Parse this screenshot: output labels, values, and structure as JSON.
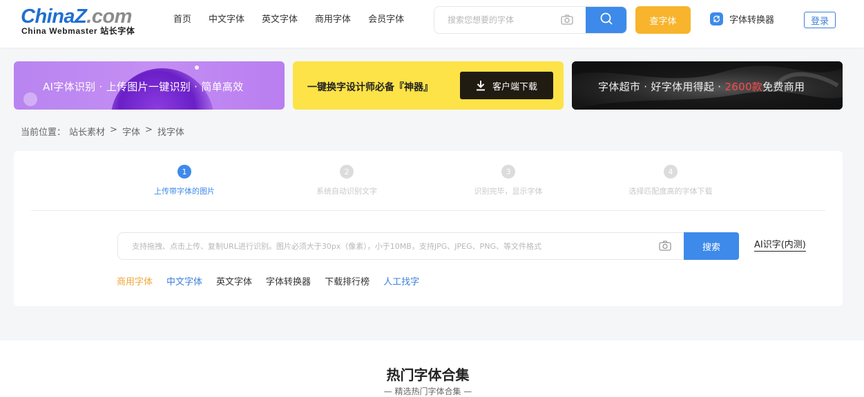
{
  "header": {
    "logo": {
      "main_blue": "China",
      "main_z": "Z",
      "main_gray": ".com",
      "sub": "China Webmaster 站长字体"
    },
    "nav": [
      "首页",
      "中文字体",
      "英文字体",
      "商用字体",
      "会员字体"
    ],
    "search": {
      "placeholder": "搜索您想要的字体",
      "camera_icon": "camera-icon",
      "search_icon": "search-icon"
    },
    "find_button": "查字体",
    "converter": {
      "label": "字体转换器",
      "icon": "converter-icon"
    },
    "login_button": "登录"
  },
  "banners": {
    "ai": "AI字体识别 · 上传图片一键识别 · 简单高效",
    "client": {
      "text": "一键换字设计师必备『神器』",
      "button": "客户端下载"
    },
    "market": {
      "text_before": "字体超市 · 好字体用得起 · ",
      "highlight": "2600款",
      "text_after": "免费商用"
    }
  },
  "breadcrumb": {
    "prefix": "当前位置：",
    "items": [
      "站长素材",
      "字体",
      "找字体"
    ],
    "separator": ">"
  },
  "steps": [
    {
      "num": "1",
      "label": "上传带字体的图片",
      "active": true
    },
    {
      "num": "2",
      "label": "系统自动识别文字",
      "active": false
    },
    {
      "num": "3",
      "label": "识别完毕，显示字体",
      "active": false
    },
    {
      "num": "4",
      "label": "选择匹配度高的字体下载",
      "active": false
    }
  ],
  "upload": {
    "placeholder": "支持拖拽、点击上传、复制URL进行识别。图片必须大于30px（像素），小于10MB，支持JPG、JPEG、PNG、等文件格式",
    "search_button": "搜索",
    "ai_link": "AI识字(内测)"
  },
  "quick_links": [
    {
      "label": "商用字体",
      "color": "#f0a73a"
    },
    {
      "label": "中文字体",
      "color": "#3d7fd9"
    },
    {
      "label": "英文字体",
      "color": "#333333"
    },
    {
      "label": "字体转换器",
      "color": "#333333"
    },
    {
      "label": "下载排行榜",
      "color": "#333333"
    },
    {
      "label": "人工找字",
      "color": "#3d7fd9"
    }
  ],
  "hot": {
    "title": "热门字体合集",
    "subtitle": "—   精选热门字体合集   —"
  },
  "colors": {
    "primary": "#3d8aea",
    "orange": "#f7b42c",
    "yellow": "#fde347",
    "purple": "#c08af2"
  }
}
